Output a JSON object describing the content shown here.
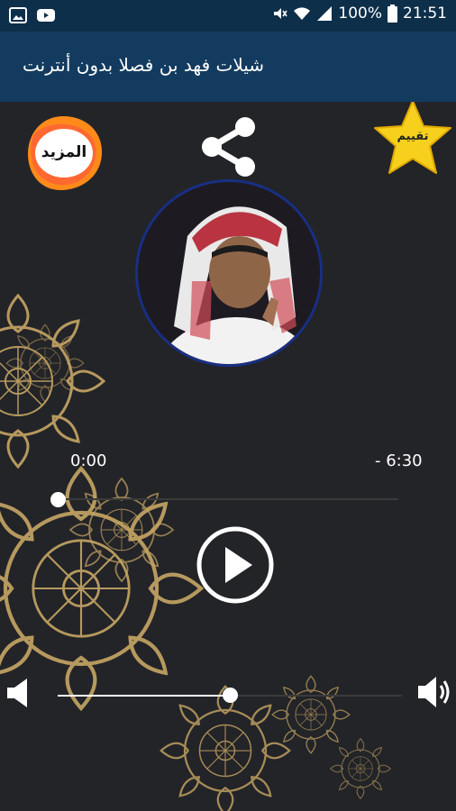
{
  "status_bar": {
    "battery": "100%",
    "time": "21:51"
  },
  "app_bar": {
    "title": "شيلات فهد بن فصلا بدون أنترنت"
  },
  "top_actions": {
    "more_label": "المزيد",
    "rate_label": "تقييم",
    "share_icon": "share-icon"
  },
  "player": {
    "current_time": "0:00",
    "remaining_time": "- 6:30",
    "progress_fraction": 0.0,
    "volume_fraction": 0.5
  },
  "colors": {
    "status_bar": "#0d2f4a",
    "app_bar": "#123b5f",
    "background": "#232428",
    "ornament_gold": "#c7a664",
    "star_yellow": "#f6d01c",
    "more_orange": "#ff8a1a"
  }
}
